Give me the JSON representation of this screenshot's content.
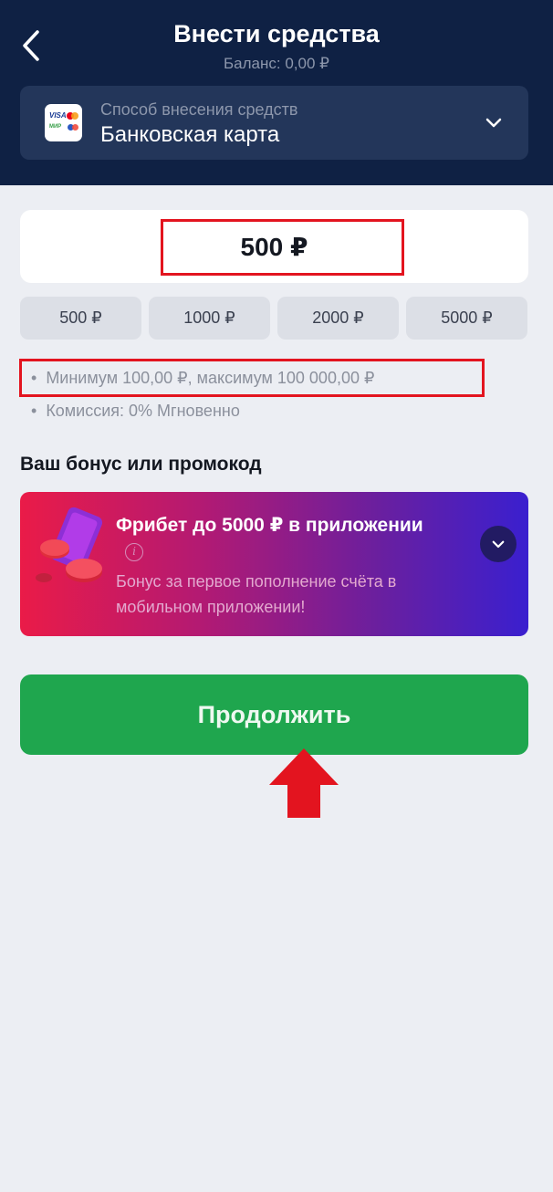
{
  "header": {
    "title": "Внести средства",
    "balance": "Баланс: 0,00 ₽"
  },
  "method": {
    "label": "Способ внесения средств",
    "value": "Банковская карта",
    "icon_visa": "VISA",
    "icon_mir": "МИР"
  },
  "amount": {
    "value": "500 ₽"
  },
  "quick_amounts": [
    "500 ₽",
    "1000 ₽",
    "2000 ₽",
    "5000 ₽"
  ],
  "info": {
    "bullet": "•",
    "limits": "Минимум 100,00 ₽, максимум 100 000,00 ₽",
    "commission": "Комиссия: 0% Мгновенно"
  },
  "bonus": {
    "heading": "Ваш бонус или промокод",
    "title": "Фрибет до 5000 ₽ в приложении",
    "info_glyph": "i",
    "description": "Бонус за первое пополнение счёта в мобильном приложении!"
  },
  "continue_label": "Продолжить",
  "colors": {
    "header_bg": "#0f2144",
    "accent_green": "#1fa64e",
    "highlight_red": "#e3141f"
  },
  "icons": [
    "back-chevron-icon",
    "bank-card-icon",
    "chevron-down-icon",
    "info-icon",
    "red-up-arrow-icon"
  ]
}
